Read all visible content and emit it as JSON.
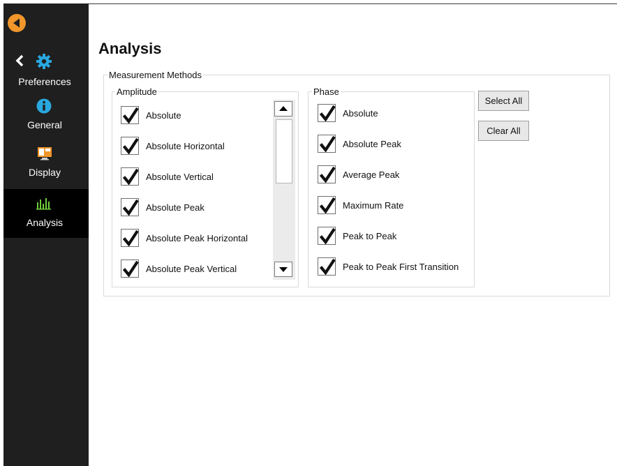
{
  "colors": {
    "sidebar_bg": "#1f1f1f",
    "active_bg": "#000000",
    "back_button": "#f0962a",
    "accent_icon": "#29a8e0",
    "analysis_icon": "#6fcf3a"
  },
  "sidebar": {
    "back_icon": "back-arrow-icon",
    "preferences": {
      "label": "Preferences",
      "icons": [
        "chevron-left-icon",
        "gear-icon"
      ]
    },
    "items": [
      {
        "label": "General",
        "icon": "info-icon",
        "active": false
      },
      {
        "label": "Display",
        "icon": "display-icon",
        "active": false
      },
      {
        "label": "Analysis",
        "icon": "bar-chart-icon",
        "active": true
      }
    ]
  },
  "page": {
    "title": "Analysis"
  },
  "measurement_methods": {
    "legend": "Measurement Methods",
    "amplitude": {
      "legend": "Amplitude",
      "items": [
        {
          "label": "Absolute",
          "checked": true
        },
        {
          "label": "Absolute Horizontal",
          "checked": true
        },
        {
          "label": "Absolute Vertical",
          "checked": true
        },
        {
          "label": "Absolute Peak",
          "checked": true
        },
        {
          "label": "Absolute Peak Horizontal",
          "checked": true
        },
        {
          "label": "Absolute Peak Vertical",
          "checked": true
        }
      ],
      "scroll_position": 0
    },
    "phase": {
      "legend": "Phase",
      "items": [
        {
          "label": "Absolute",
          "checked": true
        },
        {
          "label": "Absolute Peak",
          "checked": true
        },
        {
          "label": "Average Peak",
          "checked": true
        },
        {
          "label": "Maximum Rate",
          "checked": true
        },
        {
          "label": "Peak to Peak",
          "checked": true
        },
        {
          "label": "Peak to Peak First Transition",
          "checked": true
        }
      ]
    },
    "buttons": {
      "select_all": "Select All",
      "clear_all": "Clear All"
    }
  }
}
